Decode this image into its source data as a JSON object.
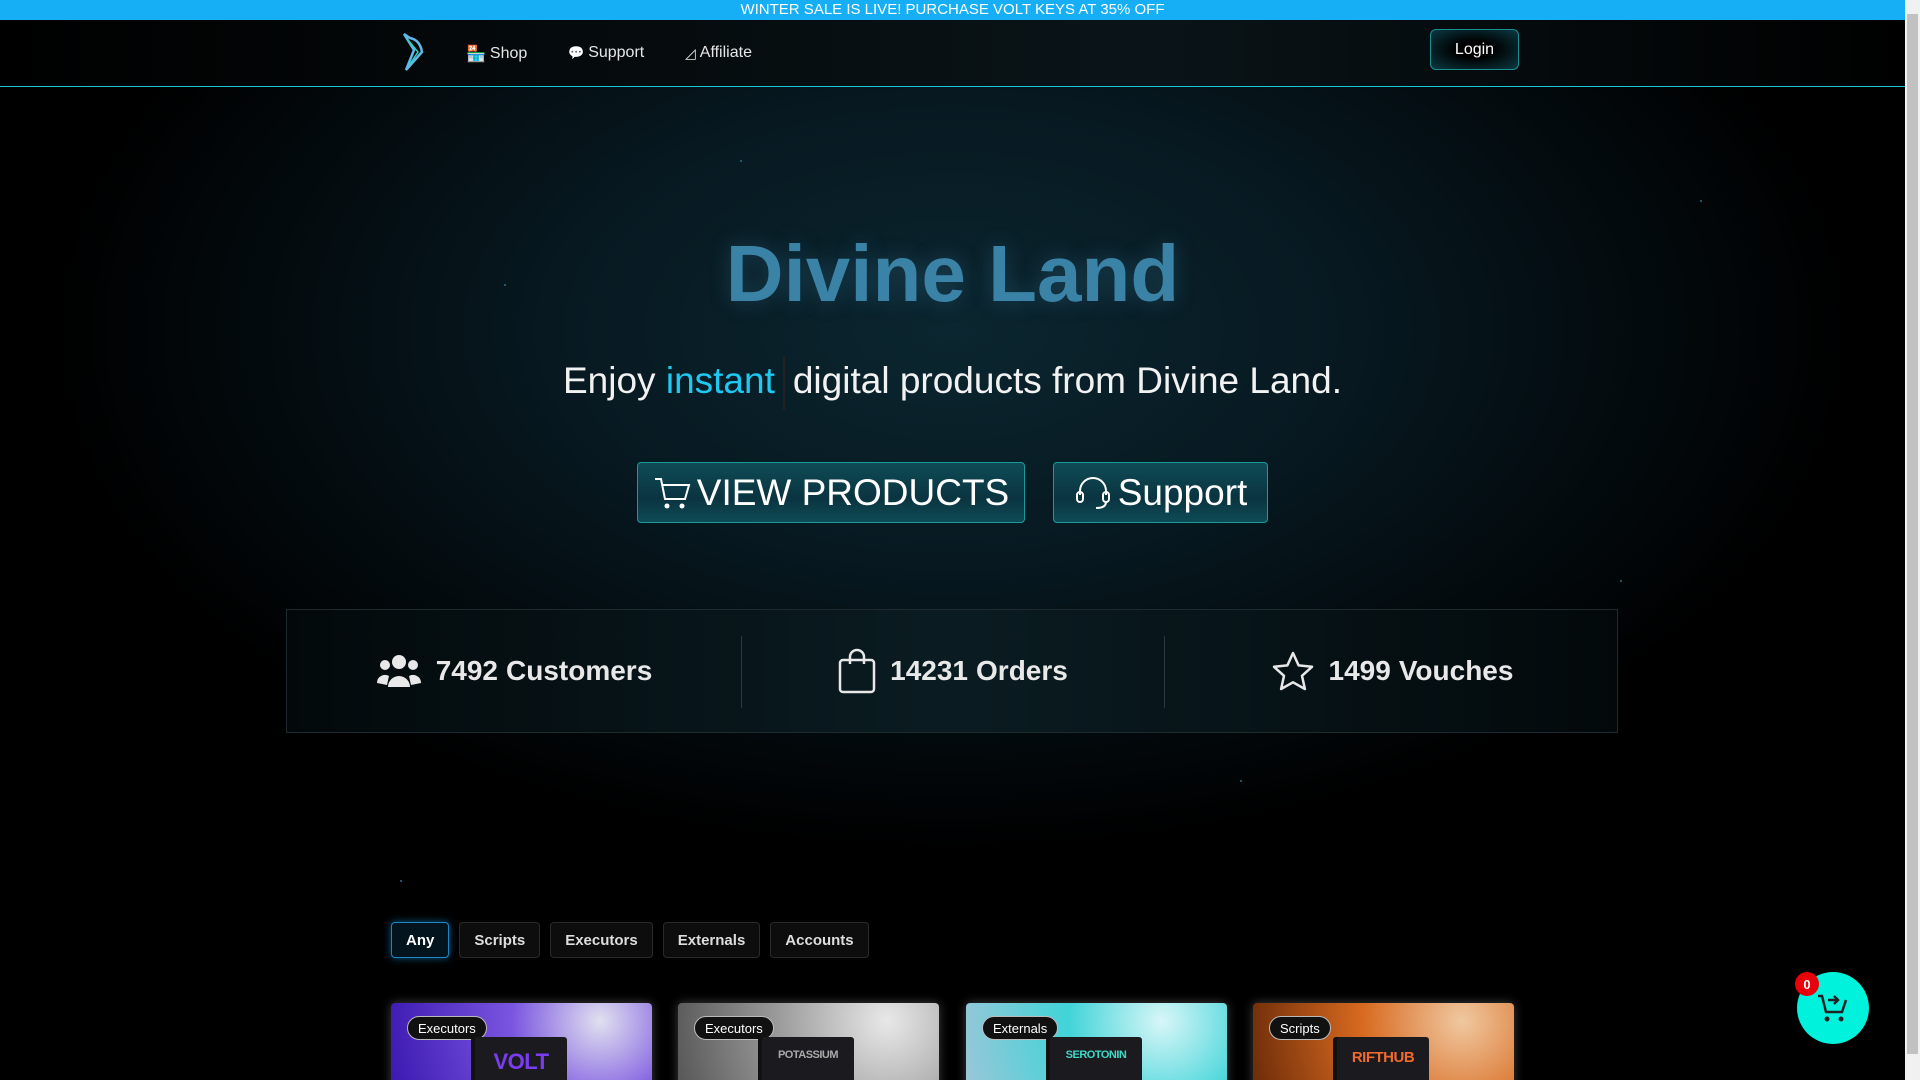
{
  "banner": {
    "text": "WINTER SALE IS LIVE! PURCHASE VOLT KEYS AT 35% OFF"
  },
  "nav": {
    "items": [
      {
        "label": "Shop",
        "icon": "store-icon"
      },
      {
        "label": "Support",
        "icon": "chat-icon"
      },
      {
        "label": "Affiliate",
        "icon": "chart-icon"
      }
    ],
    "login": "Login"
  },
  "hero": {
    "title": "Divine Land",
    "sub_pre": "Enjoy",
    "sub_highlight": "instant",
    "sub_post": "digital products from Divine Land.",
    "view_products": "VIEW PRODUCTS",
    "support": "Support"
  },
  "stats": [
    {
      "value": "7492",
      "label": "Customers",
      "icon": "users-icon"
    },
    {
      "value": "14231",
      "label": "Orders",
      "icon": "shopping-bag-icon"
    },
    {
      "value": "1499",
      "label": "Vouches",
      "icon": "star-icon"
    }
  ],
  "filters": {
    "options": [
      "Any",
      "Scripts",
      "Executors",
      "Externals",
      "Accounts"
    ],
    "selected": "Any"
  },
  "products": [
    {
      "tag": "Executors",
      "name": "VOLT",
      "accent": "#6a2cd8"
    },
    {
      "tag": "Executors",
      "name": "POTASSIUM",
      "accent": "#9a9a9a"
    },
    {
      "tag": "Externals",
      "name": "SEROTONIN",
      "accent": "#2fd0d6"
    },
    {
      "tag": "Scripts",
      "name": "RIFTHUB",
      "accent": "#e0601e"
    }
  ],
  "cart": {
    "count": "0"
  },
  "colors": {
    "banner": "#16aef5",
    "accent": "#1ec8f0",
    "title": "#3a82a6",
    "cart": "#00f2dc",
    "badge": "#e8000a"
  }
}
